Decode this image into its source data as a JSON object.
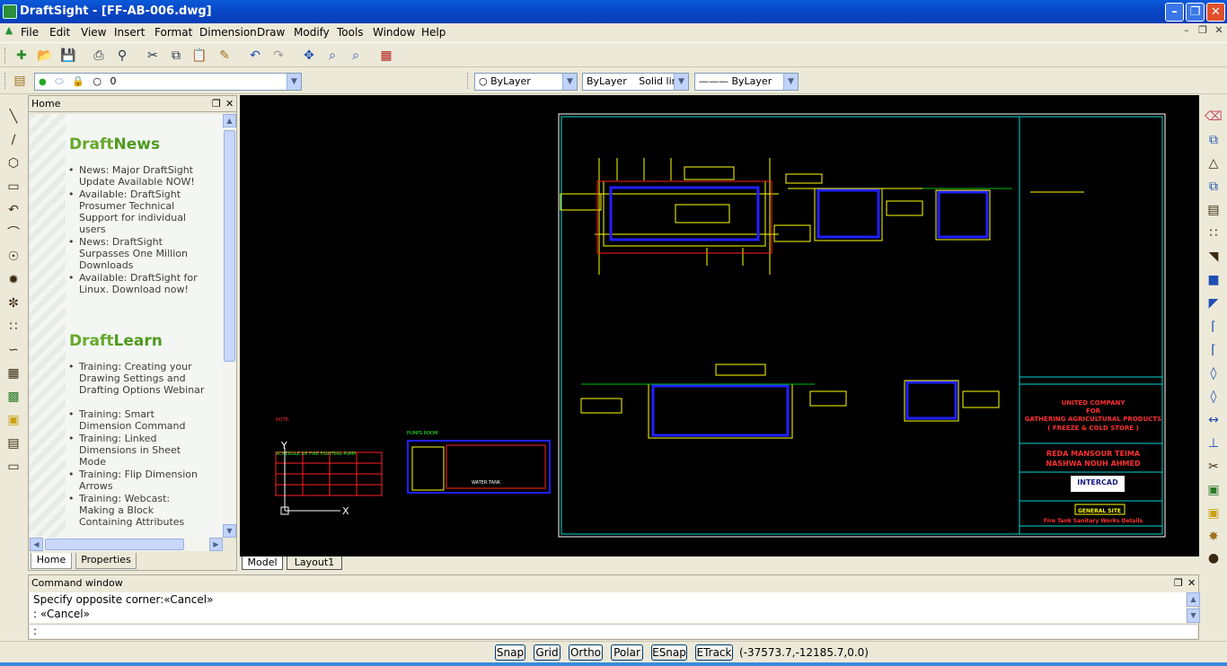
{
  "window": {
    "title": "DraftSight - [FF-AB-006.dwg]"
  },
  "menu": [
    "File",
    "Edit",
    "View",
    "Insert",
    "Format",
    "Dimension",
    "Draw",
    "Modify",
    "Tools",
    "Window",
    "Help"
  ],
  "layer_toolbar": {
    "layer_value": "0",
    "color": "ByLayer",
    "linetype_layer": "ByLayer",
    "linetype_name": "Solid line",
    "lineweight": "——— ByLayer"
  },
  "home_panel": {
    "title": "Home",
    "sections": [
      {
        "heading_a": "Draft",
        "heading_b": "News",
        "items": [
          "News: Major DraftSight Update Available NOW!",
          "Available: DraftSight Prosumer Technical Support for individual users",
          "News: DraftSight Surpasses One Million Downloads",
          "Available: DraftSight for Linux. Download now!"
        ]
      },
      {
        "heading_a": "Draft",
        "heading_b": "Learn",
        "items": [
          "Training: Creating your Drawing Settings and Drafting Options Webinar",
          "Training: Smart Dimension Command",
          "Training: Linked Dimensions in Sheet Mode",
          "Training: Flip Dimension Arrows",
          "Training: Webcast: Making a Block Containing Attributes"
        ]
      }
    ],
    "tabs": [
      "Home",
      "Properties"
    ]
  },
  "drawing": {
    "title_block": {
      "client_line1": "UNITED COMPANY",
      "client_line2": "FOR",
      "client_line3": "GATHERING AGRICULTURAL PRODUCTS",
      "client_line4": "( FREEZE & COLD STORE )",
      "name1": "REDA MANSOUR TEIMA",
      "name2": "NASHWA NOUH AHMED",
      "firm": "INTERCAD",
      "site": "GENERAL SITE",
      "sheet": "Fire Tank Sanitary Works Details"
    },
    "schedule_title": "SCHEDULE OF FIRE FIGHTING PUMP",
    "pumps_room": "PUMPS ROOM",
    "water_tank": "WATER TANK"
  },
  "layout_tabs": [
    "Model",
    "Layout1"
  ],
  "command_window": {
    "title": "Command window",
    "history": [
      "Specify opposite corner:«Cancel»",
      ": «Cancel»"
    ],
    "prompt": ":"
  },
  "status": {
    "toggles": [
      "Snap",
      "Grid",
      "Ortho",
      "Polar",
      "ESnap",
      "ETrack"
    ],
    "coords": "(-37573.7,-12185.7,0.0)"
  }
}
